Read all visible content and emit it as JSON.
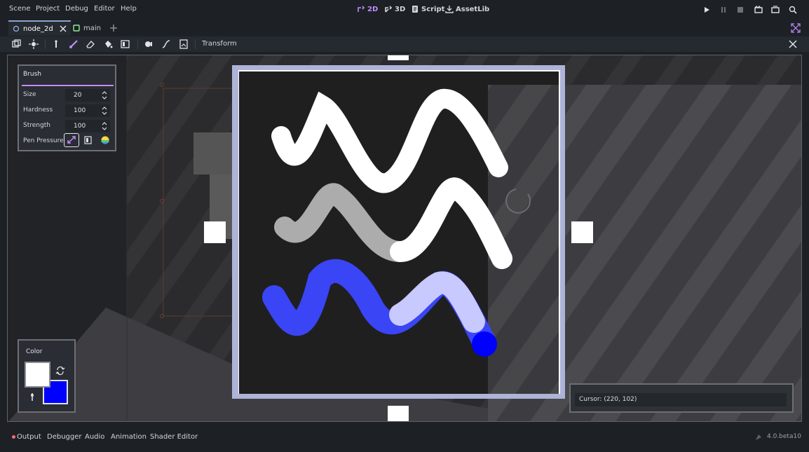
{
  "menu": {
    "items": [
      {
        "label": "Scene"
      },
      {
        "label": "Project"
      },
      {
        "label": "Debug"
      },
      {
        "label": "Editor"
      },
      {
        "label": "Help"
      }
    ]
  },
  "workspaces": {
    "items": [
      {
        "label": "2D",
        "active": true,
        "icon": "2d-workspace-icon"
      },
      {
        "label": "3D",
        "active": false,
        "icon": "3d-workspace-icon"
      },
      {
        "label": "Script",
        "active": false,
        "icon": "script-icon"
      },
      {
        "label": "AssetLib",
        "active": false,
        "icon": "assetlib-icon"
      }
    ]
  },
  "run_controls": [
    "play-icon",
    "pause-icon",
    "stop-icon",
    "play-scene-icon",
    "play-custom-scene-icon",
    "movie-maker-icon"
  ],
  "tabs": {
    "items": [
      {
        "label": "node_2d",
        "active": true,
        "icon": "node2d-icon"
      },
      {
        "label": "main",
        "active": false,
        "icon": "control-icon"
      }
    ],
    "add_icon": "plus-icon"
  },
  "toolbar": {
    "tools": [
      "duplicate-icon",
      "pivot-icon",
      "color-picker-icon",
      "paint-brush-icon",
      "eraser-icon",
      "bucket-fill-icon",
      "replace-color-icon",
      "brush-shape-icon",
      "curve-icon",
      "image-icon"
    ],
    "transform_label": "Transform",
    "close_icon": "close-icon",
    "expand_icon": "expand-icon"
  },
  "brush_panel": {
    "title": "Brush",
    "fields": [
      {
        "label": "Size",
        "value": "20"
      },
      {
        "label": "Hardness",
        "value": "100"
      },
      {
        "label": "Strength",
        "value": "100"
      }
    ],
    "pen_pressure_label": "Pen Pressure",
    "pen_pressure_icons": [
      "pressure-size-icon",
      "pressure-opacity-icon",
      "pressure-color-icon"
    ]
  },
  "color_panel": {
    "title": "Color",
    "primary_color": "#ffffff",
    "secondary_color": "#0000ff",
    "swap_icon": "swap-icon",
    "picker_icon": "eyedropper-icon"
  },
  "cursor_panel": {
    "text": "Cursor: (220, 102)"
  },
  "bottom": {
    "tabs": [
      {
        "label": "Output",
        "indicator_color": "#ff6b6b"
      },
      {
        "label": "Debugger"
      },
      {
        "label": "Audio"
      },
      {
        "label": "Animation"
      },
      {
        "label": "Shader Editor"
      }
    ],
    "version": "4.0.beta10"
  },
  "colors": {
    "accent": "#c28cff",
    "frame_border": "#aeb4d8",
    "canvas_bg": "#1f1f1f",
    "stroke_white": "#ffffff",
    "stroke_blue": "#0000ff"
  }
}
